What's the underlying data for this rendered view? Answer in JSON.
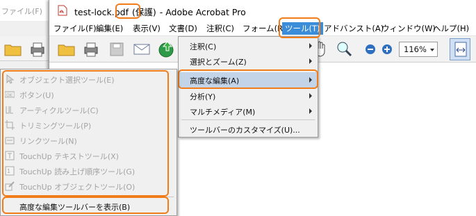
{
  "background_window": {
    "title": "ファイル(F)",
    "menu_label": "ファイル(F)"
  },
  "window": {
    "title": "test-lock.pdf (保護) - Adobe Acrobat Pro",
    "filename": "test-lock.pdf",
    "protected_label": "(保護)",
    "app_name": "- Adobe Acrobat Pro"
  },
  "menubar": {
    "items": [
      "ファイル(F)",
      "編集(E)",
      "表示(V)",
      "文書(D)",
      "注釈(C)",
      "フォーム(R)",
      "ツール(T)",
      "アドバンスト(A)",
      "ウィンドウ(W)",
      "ヘルプ(H)"
    ],
    "active": "ツール(T)"
  },
  "toolbar": {
    "zoom_value": "116%"
  },
  "tools_menu": {
    "items": [
      {
        "label": "注釈(C)",
        "submenu": true
      },
      {
        "label": "選択とズーム(Z)",
        "submenu": true
      },
      {
        "label": "高度な編集(A)",
        "submenu": true,
        "highlighted": true
      },
      {
        "label": "分析(Y)",
        "submenu": true
      },
      {
        "label": "マルチメディア(M)",
        "submenu": true
      },
      {
        "label": "ツールバーのカスタマイズ(U)...",
        "submenu": false
      }
    ]
  },
  "advanced_editing_menu": {
    "items": [
      {
        "label": "オブジェクト選択ツール(E)",
        "icon": "arrow-select-icon",
        "disabled": true
      },
      {
        "label": "ボタン(U)",
        "icon": "button-icon",
        "disabled": true
      },
      {
        "label": "アーティクルツール(C)",
        "icon": "article-icon",
        "disabled": true
      },
      {
        "label": "トリミングツール(P)",
        "icon": "crop-icon",
        "disabled": true
      },
      {
        "label": "リンクツール(N)",
        "icon": "link-icon",
        "disabled": true
      },
      {
        "label": "TouchUp テキストツール(X)",
        "icon": "touchup-text-icon",
        "disabled": true
      },
      {
        "label": "TouchUp 読み上げ順序ツール(G)",
        "icon": "reading-order-icon",
        "disabled": true
      },
      {
        "label": "TouchUp オブジェクトツール(O)",
        "icon": "touchup-object-icon",
        "disabled": true
      }
    ],
    "footer": "高度な編集ツールバーを表示(B)"
  },
  "colors": {
    "highlight": "#f07d1a",
    "menu_selection": "#3b8cd9",
    "hover_item": "#c3d4e8"
  }
}
